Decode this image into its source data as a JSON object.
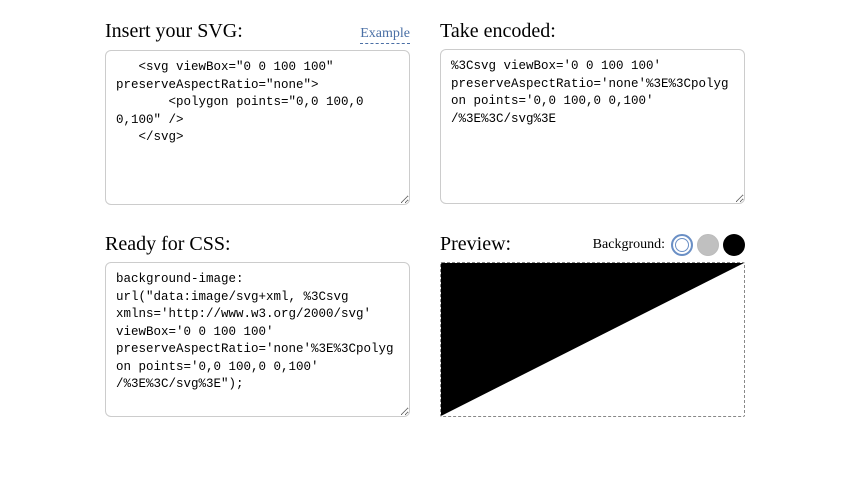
{
  "panels": {
    "input": {
      "title": "Insert your SVG:",
      "example_label": "Example",
      "value": "   <svg viewBox=\"0 0 100 100\" preserveAspectRatio=\"none\">\n       <polygon points=\"0,0 100,0 0,100\" />\n   </svg>"
    },
    "encoded": {
      "title": "Take encoded:",
      "value": "%3Csvg viewBox='0 0 100 100' preserveAspectRatio='none'%3E%3Cpolygon points='0,0 100,0 0,100' /%3E%3C/svg%3E"
    },
    "css": {
      "title": "Ready for CSS:",
      "value": "background-image: url(\"data:image/svg+xml, %3Csvg xmlns='http://www.w3.org/2000/svg' viewBox='0 0 100 100' preserveAspectRatio='none'%3E%3Cpolygon points='0,0 100,0 0,100' /%3E%3C/svg%3E\");"
    },
    "preview": {
      "title": "Preview:",
      "bg_label": "Background:",
      "swatches": {
        "white": "#ffffff",
        "silver": "#c0c0c0",
        "black": "#000000"
      },
      "selected": "white"
    }
  }
}
